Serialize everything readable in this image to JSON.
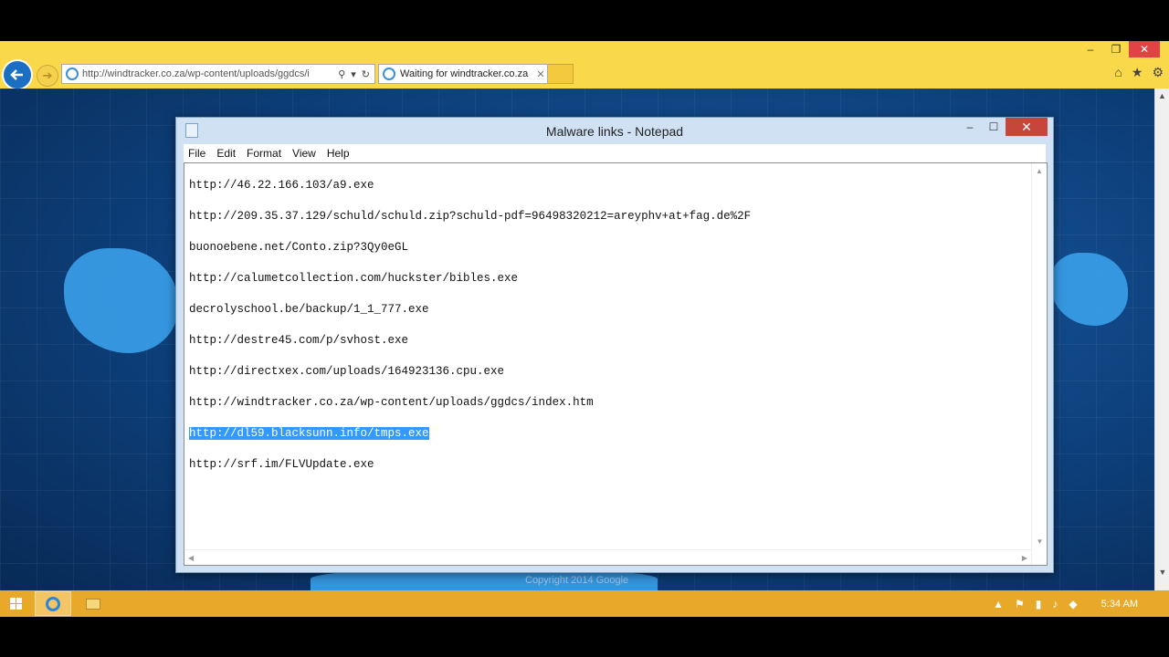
{
  "browser": {
    "window_controls": [
      "–",
      "❐",
      "✕"
    ],
    "address_bar_url": "http://windtracker.co.za/wp-content/uploads/ggdcs/i",
    "tab_title": "Waiting for windtracker.co.za",
    "icons": [
      "back-arrow-icon",
      "forward-arrow-icon",
      "search-icon",
      "refresh-icon",
      "home-icon",
      "star-icon",
      "gear-icon"
    ]
  },
  "page": {
    "copyright": "Copyright 2014 Google"
  },
  "notepad": {
    "title": "Malware links - Notepad",
    "menu": [
      "File",
      "Edit",
      "Format",
      "View",
      "Help"
    ],
    "lines": [
      "http://46.22.166.103/a9.exe",
      "",
      "http://209.35.37.129/schuld/schuld.zip?schuld-pdf=96498320212=areyphv+at+fag.de%2F",
      "",
      "buonoebene.net/Conto.zip?3Qy0eGL",
      "",
      "http://calumetcollection.com/huckster/bibles.exe",
      "",
      "decrolyschool.be/backup/1_1_777.exe",
      "",
      "http://destre45.com/p/svhost.exe",
      "",
      "http://directxex.com/uploads/164923136.cpu.exe",
      "",
      "http://windtracker.co.za/wp-content/uploads/ggdcs/index.htm",
      "",
      "http://dl59.blacksunn.info/tmps.exe",
      "",
      "http://srf.im/FLVUpdate.exe"
    ],
    "selected_line_index": 16
  },
  "taskbar": {
    "clock": "5:34 AM"
  }
}
